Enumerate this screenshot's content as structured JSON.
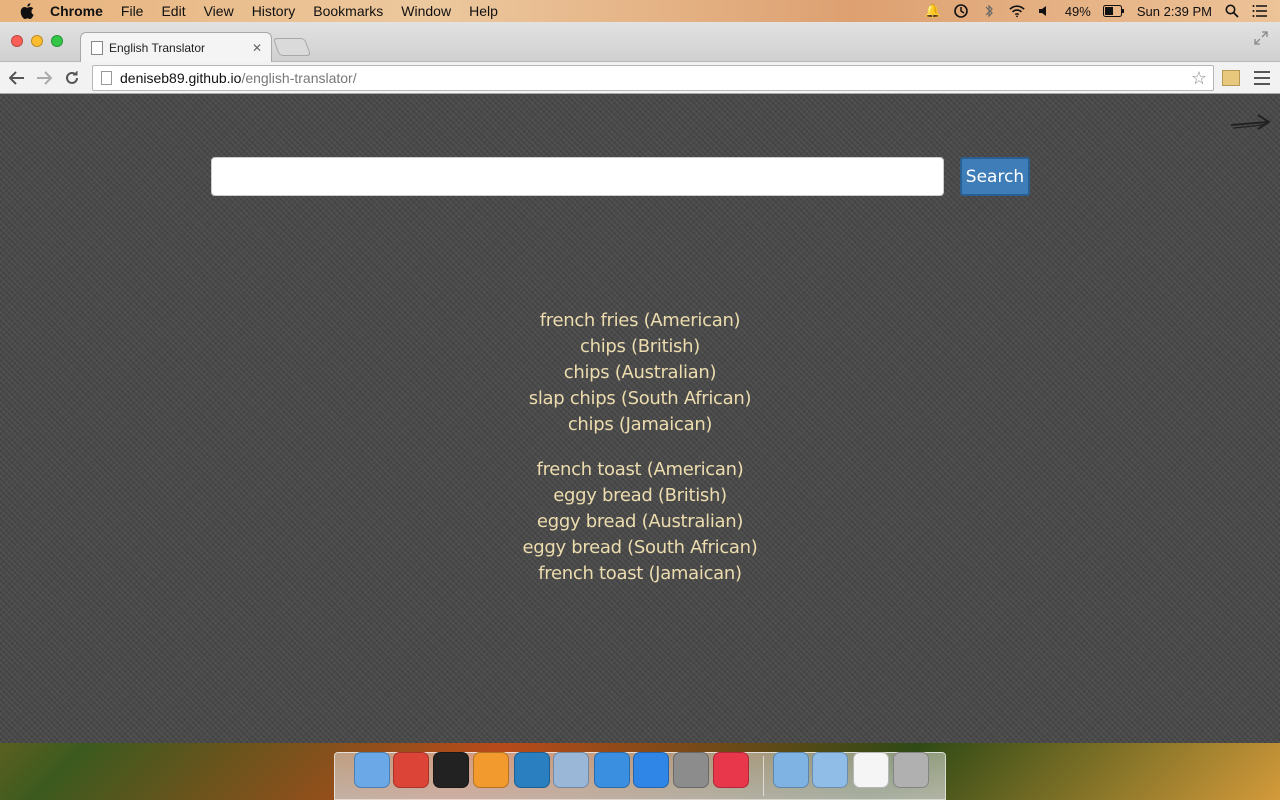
{
  "menubar": {
    "app_name": "Chrome",
    "items": [
      "File",
      "Edit",
      "View",
      "History",
      "Bookmarks",
      "Window",
      "Help"
    ],
    "battery_percent": "49%",
    "clock": "Sun 2:39 PM"
  },
  "browser": {
    "tab_title": "English Translator",
    "url_host": "deniseb89.github.io",
    "url_path": "/english-translator/"
  },
  "page": {
    "search_placeholder": "",
    "search_value": "",
    "search_button_label": "Search",
    "result_groups": [
      {
        "lines": [
          "french fries (American)",
          "chips (British)",
          "chips (Australian)",
          "slap chips (South African)",
          "chips (Jamaican)"
        ]
      },
      {
        "lines": [
          "french toast (American)",
          "eggy bread (British)",
          "eggy bread (Australian)",
          "eggy bread (South African)",
          "french toast (Jamaican)"
        ]
      }
    ]
  },
  "dock": {
    "apps": [
      {
        "icon": "finder-icon",
        "color": "#6aa8e8"
      },
      {
        "icon": "chrome-icon",
        "color": "#db4437"
      },
      {
        "icon": "terminal-icon",
        "color": "#222222"
      },
      {
        "icon": "sublime-text-icon",
        "color": "#f29a2e"
      },
      {
        "icon": "chat-icon",
        "color": "#2a7fc0"
      },
      {
        "icon": "preview-icon",
        "color": "#9ab7d8"
      },
      {
        "icon": "safari-icon",
        "color": "#3b8fe0"
      },
      {
        "icon": "app-store-icon",
        "color": "#2f86e6"
      },
      {
        "icon": "system-preferences-icon",
        "color": "#8c8c8c"
      },
      {
        "icon": "itunes-icon",
        "color": "#e8364a"
      },
      {
        "icon": "applications-folder-icon",
        "color": "#7eb3e4"
      },
      {
        "icon": "documents-folder-icon",
        "color": "#8fbde8"
      },
      {
        "icon": "document-icon",
        "color": "#f5f5f5"
      },
      {
        "icon": "trash-icon",
        "color": "#b0b0b0"
      }
    ]
  }
}
